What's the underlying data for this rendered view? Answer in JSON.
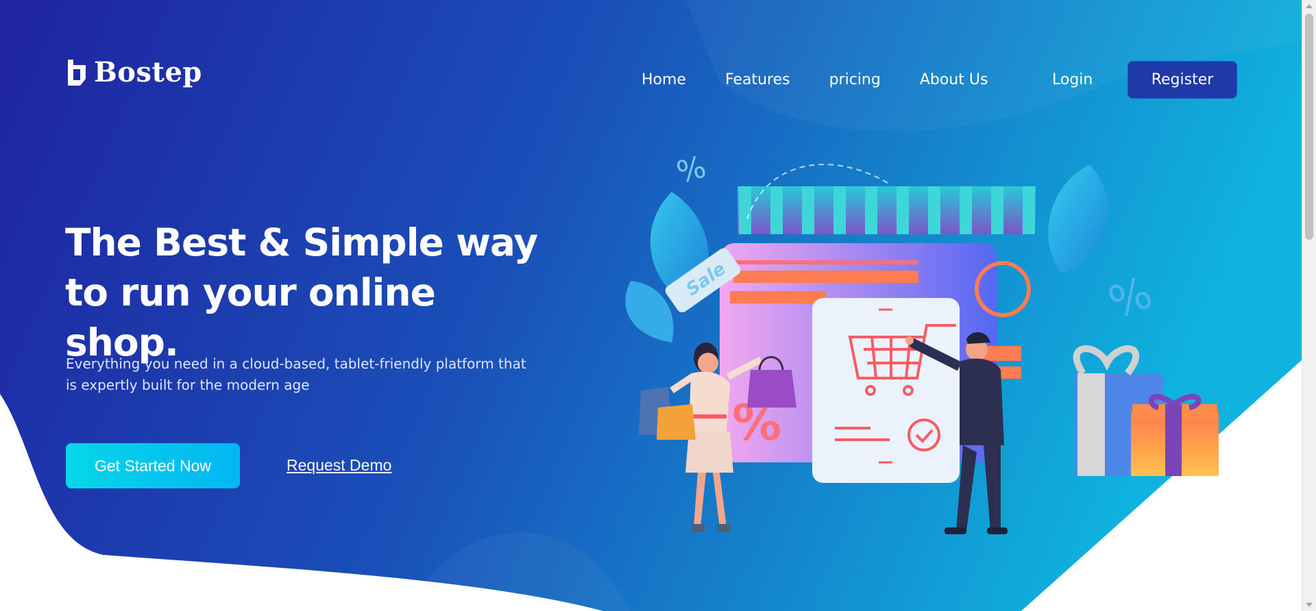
{
  "brand": {
    "name": "Bostep"
  },
  "nav": {
    "items": [
      {
        "label": "Home"
      },
      {
        "label": "Features"
      },
      {
        "label": "pricing"
      },
      {
        "label": "About Us"
      }
    ],
    "login_label": "Login",
    "register_label": "Register"
  },
  "hero": {
    "headline": "The Best & Simple way to run your online shop.",
    "subtext": "Everything you need in a cloud-based, tablet-friendly platform that is expertly built for the modern age",
    "cta_label": "Get Started Now",
    "demo_label": "Request Demo"
  },
  "illustration": {
    "sale_tag": "Sale",
    "percent_symbol": "%"
  },
  "colors": {
    "bg_start": "#1f23a0",
    "bg_end": "#0fb3df",
    "cta": "#05d0ec",
    "register_bg": "#1e3aa8"
  }
}
